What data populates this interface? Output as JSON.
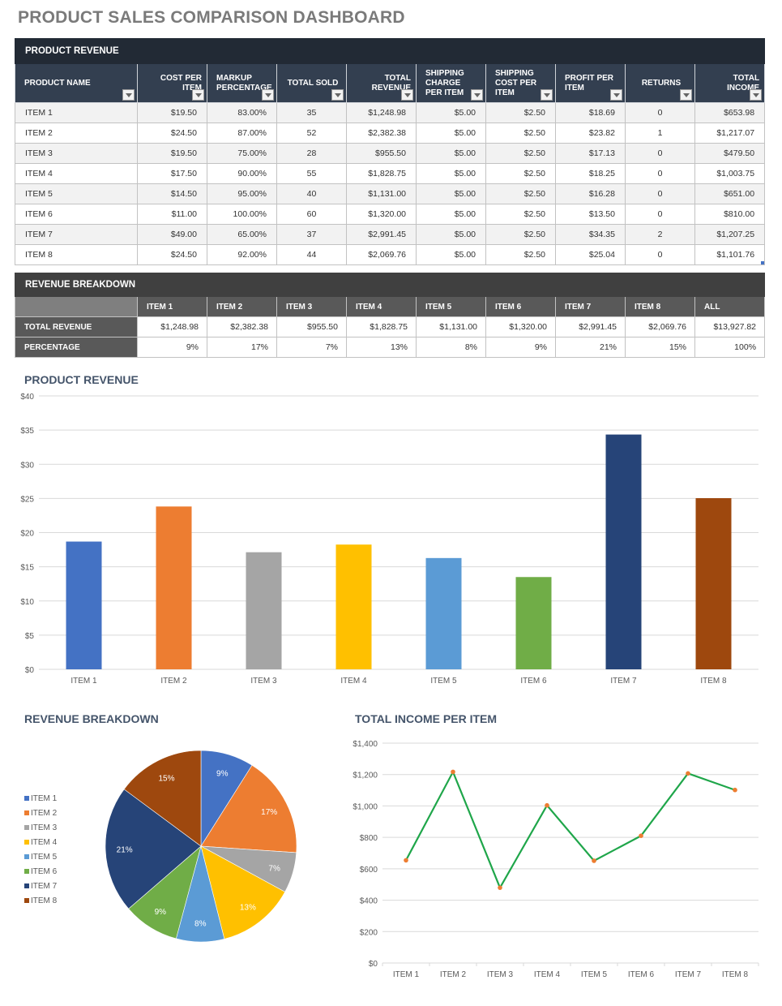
{
  "page_title": "PRODUCT SALES COMPARISON DASHBOARD",
  "product_revenue_table": {
    "section_title": "PRODUCT REVENUE",
    "columns": [
      "PRODUCT NAME",
      "COST PER ITEM",
      "MARKUP PERCENTAGE",
      "TOTAL SOLD",
      "TOTAL REVENUE",
      "SHIPPING CHARGE PER ITEM",
      "SHIPPING COST PER ITEM",
      "PROFIT PER ITEM",
      "RETURNS",
      "TOTAL INCOME"
    ],
    "rows": [
      [
        "ITEM 1",
        "$19.50",
        "83.00%",
        "35",
        "$1,248.98",
        "$5.00",
        "$2.50",
        "$18.69",
        "0",
        "$653.98"
      ],
      [
        "ITEM 2",
        "$24.50",
        "87.00%",
        "52",
        "$2,382.38",
        "$5.00",
        "$2.50",
        "$23.82",
        "1",
        "$1,217.07"
      ],
      [
        "ITEM 3",
        "$19.50",
        "75.00%",
        "28",
        "$955.50",
        "$5.00",
        "$2.50",
        "$17.13",
        "0",
        "$479.50"
      ],
      [
        "ITEM 4",
        "$17.50",
        "90.00%",
        "55",
        "$1,828.75",
        "$5.00",
        "$2.50",
        "$18.25",
        "0",
        "$1,003.75"
      ],
      [
        "ITEM 5",
        "$14.50",
        "95.00%",
        "40",
        "$1,131.00",
        "$5.00",
        "$2.50",
        "$16.28",
        "0",
        "$651.00"
      ],
      [
        "ITEM 6",
        "$11.00",
        "100.00%",
        "60",
        "$1,320.00",
        "$5.00",
        "$2.50",
        "$13.50",
        "0",
        "$810.00"
      ],
      [
        "ITEM 7",
        "$49.00",
        "65.00%",
        "37",
        "$2,991.45",
        "$5.00",
        "$2.50",
        "$34.35",
        "2",
        "$1,207.25"
      ],
      [
        "ITEM 8",
        "$24.50",
        "92.00%",
        "44",
        "$2,069.76",
        "$5.00",
        "$2.50",
        "$25.04",
        "0",
        "$1,101.76"
      ]
    ]
  },
  "revenue_breakdown_table": {
    "section_title": "REVENUE BREAKDOWN",
    "columns": [
      "ITEM 1",
      "ITEM 2",
      "ITEM 3",
      "ITEM 4",
      "ITEM 5",
      "ITEM 6",
      "ITEM 7",
      "ITEM 8",
      "ALL"
    ],
    "rows": [
      {
        "label": "TOTAL REVENUE",
        "values": [
          "$1,248.98",
          "$2,382.38",
          "$955.50",
          "$1,828.75",
          "$1,131.00",
          "$1,320.00",
          "$2,991.45",
          "$2,069.76",
          "$13,927.82"
        ]
      },
      {
        "label": "PERCENTAGE",
        "values": [
          "9%",
          "17%",
          "7%",
          "13%",
          "8%",
          "9%",
          "21%",
          "15%",
          "100%"
        ]
      }
    ]
  },
  "colors": {
    "item_palette": [
      "#4472c4",
      "#ed7d31",
      "#a5a5a5",
      "#ffc000",
      "#5b9bd5",
      "#70ad47",
      "#264478",
      "#9e480e"
    ],
    "line": "#1fa64a",
    "marker": "#ed7d31"
  },
  "chart_data": [
    {
      "type": "bar",
      "title": "PRODUCT REVENUE",
      "categories": [
        "ITEM 1",
        "ITEM 2",
        "ITEM 3",
        "ITEM 4",
        "ITEM 5",
        "ITEM 6",
        "ITEM 7",
        "ITEM 8"
      ],
      "values": [
        18.69,
        23.82,
        17.13,
        18.25,
        16.28,
        13.5,
        34.35,
        25.04
      ],
      "xlabel": "",
      "ylabel": "",
      "ylim": [
        0,
        40
      ],
      "yticks": [
        0,
        5,
        10,
        15,
        20,
        25,
        30,
        35,
        40
      ],
      "ytick_labels": [
        "$0",
        "$5",
        "$10",
        "$15",
        "$20",
        "$25",
        "$30",
        "$35",
        "$40"
      ],
      "grid": true
    },
    {
      "type": "pie",
      "title": "REVENUE BREAKDOWN",
      "categories": [
        "ITEM 1",
        "ITEM 2",
        "ITEM 3",
        "ITEM 4",
        "ITEM 5",
        "ITEM 6",
        "ITEM 7",
        "ITEM 8"
      ],
      "values": [
        1248.98,
        2382.38,
        955.5,
        1828.75,
        1131.0,
        1320.0,
        2991.45,
        2069.76
      ],
      "labels": [
        "9%",
        "17%",
        "7%",
        "13%",
        "8%",
        "9%",
        "21%",
        "15%"
      ],
      "legend": "left"
    },
    {
      "type": "line",
      "title": "TOTAL INCOME PER ITEM",
      "categories": [
        "ITEM 1",
        "ITEM 2",
        "ITEM 3",
        "ITEM 4",
        "ITEM 5",
        "ITEM 6",
        "ITEM 7",
        "ITEM 8"
      ],
      "values": [
        653.98,
        1217.07,
        479.5,
        1003.75,
        651.0,
        810.0,
        1207.25,
        1101.76
      ],
      "xlabel": "",
      "ylabel": "",
      "ylim": [
        0,
        1400
      ],
      "yticks": [
        0,
        200,
        400,
        600,
        800,
        1000,
        1200,
        1400
      ],
      "ytick_labels": [
        "$0",
        "$200",
        "$400",
        "$600",
        "$800",
        "$1,000",
        "$1,200",
        "$1,400"
      ],
      "grid": true
    }
  ]
}
